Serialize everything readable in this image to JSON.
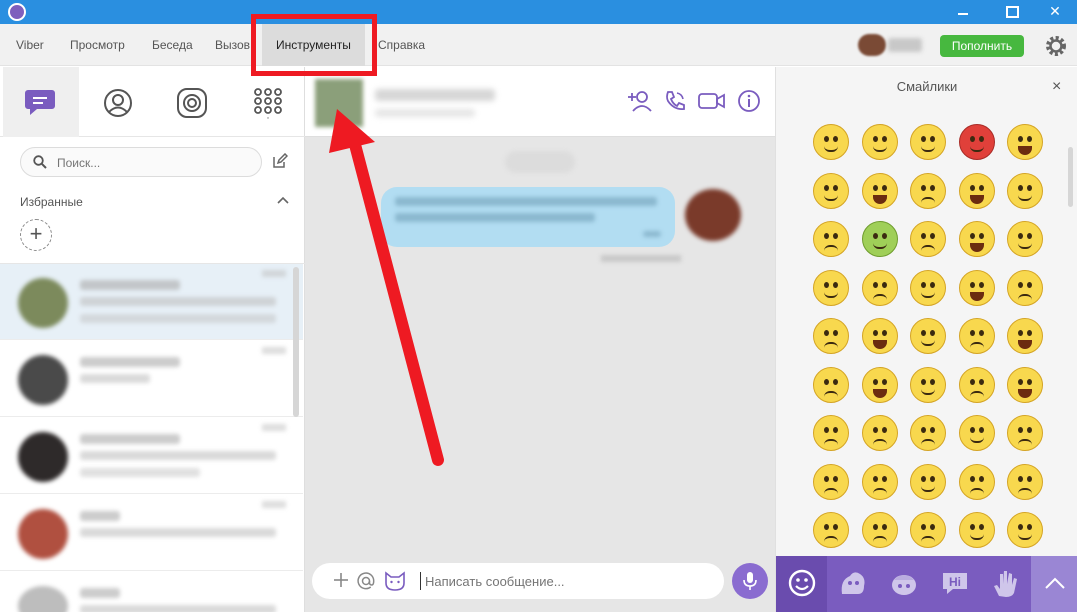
{
  "menubar": {
    "items": [
      "Viber",
      "Просмотр",
      "Беседа",
      "Вызов",
      "Инструменты",
      "Справка"
    ],
    "active_item": "Инструменты",
    "topup_label": "Пополнить"
  },
  "left_panel": {
    "search_placeholder": "Поиск...",
    "favorites_label": "Избранные",
    "add_label": "+"
  },
  "composer": {
    "placeholder": "Написать сообщение..."
  },
  "emoji_panel": {
    "title": "Смайлики",
    "close_label": "×",
    "hi_label": "Hi"
  },
  "colors": {
    "titlebar": "#2a8fe0",
    "accent": "#7a5cbf",
    "topup": "#47b83f",
    "highlight": "#ee1a22",
    "bubble": "#b2ddf2"
  },
  "icons": [
    "viber-logo-icon",
    "minimize-icon",
    "maximize-icon",
    "close-icon",
    "settings-gear-icon",
    "chats-icon",
    "contacts-icon",
    "public-accounts-icon",
    "dialpad-icon",
    "search-icon",
    "compose-icon",
    "chevron-up-icon",
    "add-participant-icon",
    "voice-call-icon",
    "video-call-icon",
    "info-icon",
    "plus-icon",
    "at-icon",
    "sticker-icon",
    "microphone-icon",
    "smiley-tab-icon",
    "sticker-pack-icon",
    "hi-sticker-icon",
    "hand-sticker-icon",
    "expand-up-icon"
  ]
}
